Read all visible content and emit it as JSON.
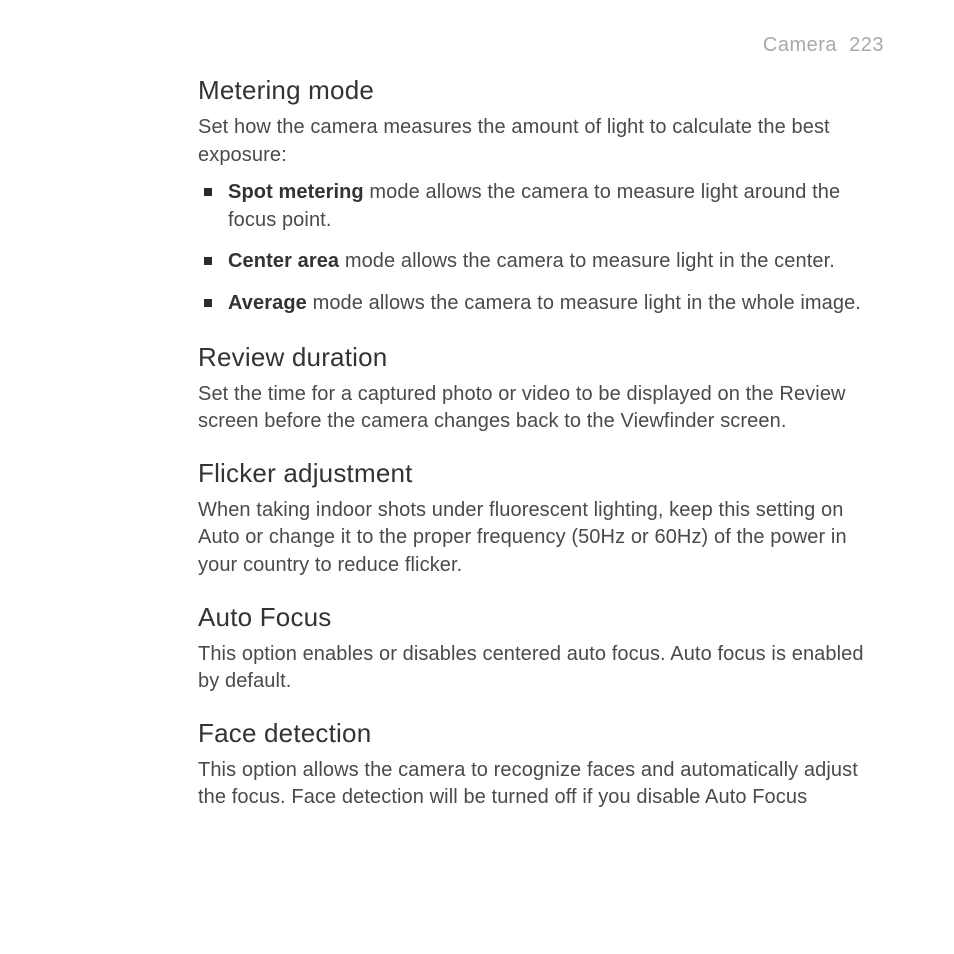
{
  "header": {
    "section": "Camera",
    "page_number": "223"
  },
  "sections": {
    "metering": {
      "heading": "Metering mode",
      "intro": "Set how the camera measures the amount of light to calculate the best exposure:",
      "items": [
        {
          "bold": "Spot metering",
          "text": " mode allows the camera to measure light around the focus point."
        },
        {
          "bold": "Center area",
          "text": " mode allows the camera to measure light in the center."
        },
        {
          "bold": "Average",
          "text": " mode allows the camera to measure light in the whole image."
        }
      ]
    },
    "review": {
      "heading": "Review duration",
      "body": "Set the time for a captured photo or video to be displayed on the Review screen before the camera changes back to the Viewfinder screen."
    },
    "flicker": {
      "heading": "Flicker adjustment",
      "body": "When taking indoor shots under fluorescent lighting, keep this setting on Auto or change it to the proper frequency (50Hz or 60Hz) of the power in your country to reduce flicker."
    },
    "autofocus": {
      "heading": "Auto Focus",
      "body": "This option enables or disables centered auto focus. Auto focus is enabled by default."
    },
    "face": {
      "heading": "Face detection",
      "body": "This option allows the camera to recognize faces and automatically adjust the focus. Face detection will be turned off if you disable Auto Focus"
    }
  }
}
